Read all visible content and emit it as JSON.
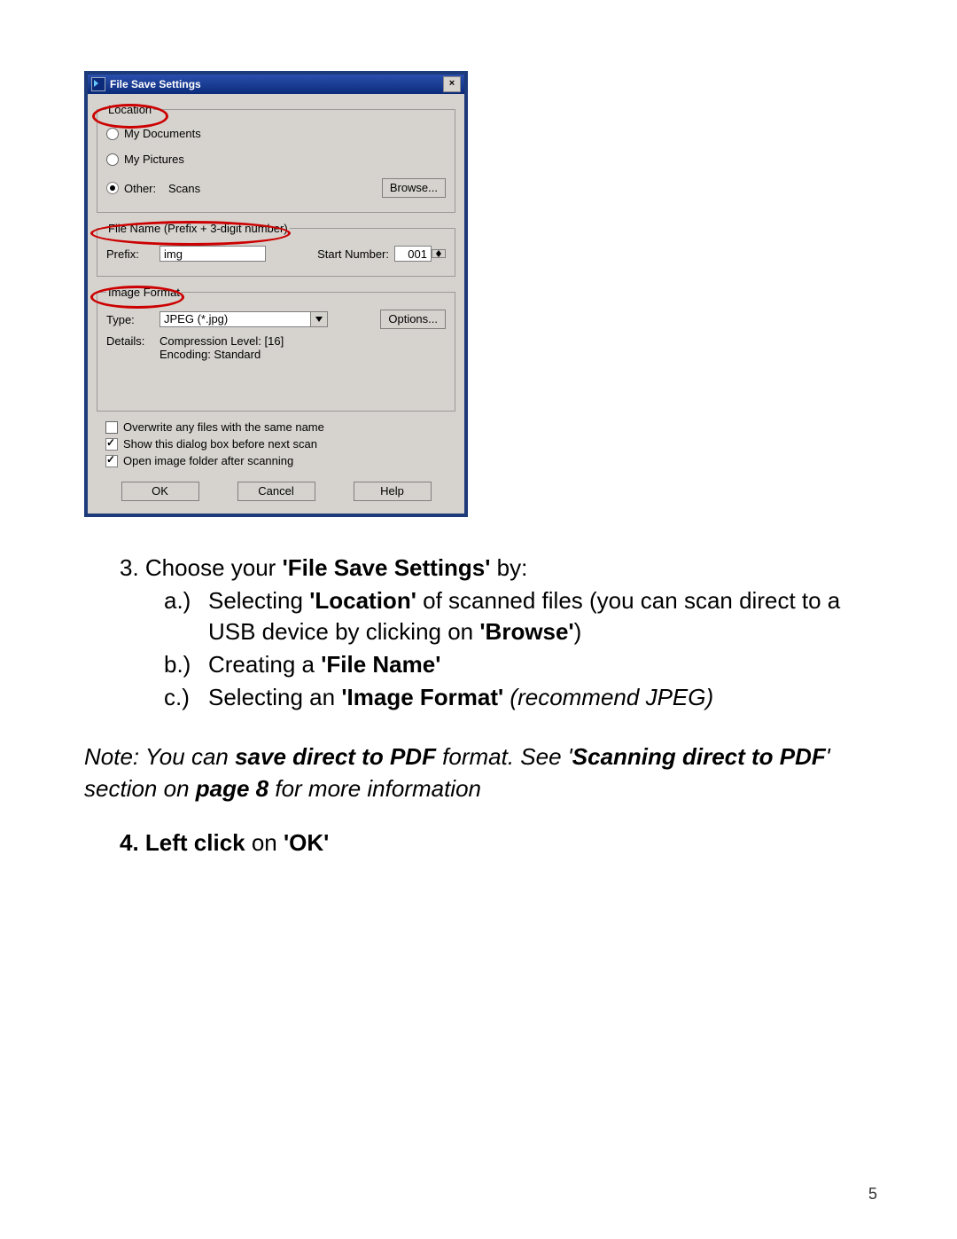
{
  "dialog": {
    "title": "File Save Settings",
    "location": {
      "legend": "Location",
      "opt_my_documents": "My Documents",
      "opt_my_pictures": "My Pictures",
      "opt_other": "Other:",
      "other_value": "Scans",
      "browse": "Browse..."
    },
    "filename": {
      "legend": "File Name (Prefix + 3-digit number)",
      "prefix_label": "Prefix:",
      "prefix_value": "img",
      "start_label": "Start Number:",
      "start_value": "001"
    },
    "format": {
      "legend": "Image Format",
      "type_label": "Type:",
      "type_value": "JPEG (*.jpg)",
      "options": "Options...",
      "details_label": "Details:",
      "details_line1": "Compression Level: [16]",
      "details_line2": "Encoding: Standard"
    },
    "checks": {
      "overwrite": "Overwrite any files with the same name",
      "showdlg": "Show this dialog box before next scan",
      "openfolder": "Open image folder after scanning"
    },
    "buttons": {
      "ok": "OK",
      "cancel": "Cancel",
      "help": "Help"
    },
    "close": "×"
  },
  "instructions": {
    "step3_lead": "3. Choose your ",
    "step3_bold": "'File Save Settings'",
    "step3_tail": " by:",
    "a_lead": "Selecting ",
    "a_bold1": "'Location'",
    "a_mid": " of scanned files (you can scan direct to a USB device by clicking on ",
    "a_bold2": "'Browse'",
    "a_tail": ")",
    "b_lead": "Creating a ",
    "b_bold": "'File Name'",
    "c_lead": "Selecting an ",
    "c_bold": "'Image Format'",
    "c_tail_it": " (recommend JPEG)",
    "note_1": "Note: You can ",
    "note_b1": "save direct to PDF",
    "note_2": " format. See '",
    "note_b2": "Scanning direct to PDF",
    "note_3": "' section on ",
    "note_b3": "page 8",
    "note_4": " for more information",
    "step4_bold": "4. Left click",
    "step4_mid": " on ",
    "step4_bold2": "'OK'"
  },
  "page_number": "5"
}
